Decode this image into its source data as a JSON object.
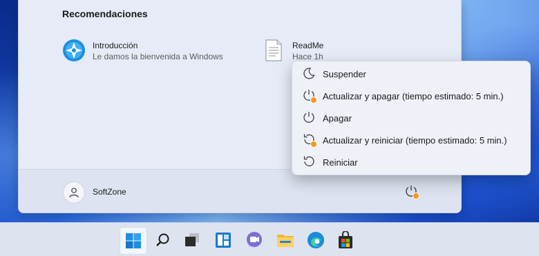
{
  "start_menu": {
    "recommended_title": "Recomendaciones",
    "recommended": [
      {
        "title": "Introducción",
        "subtitle": "Le damos la bienvenida a Windows",
        "icon": "get-started-icon"
      },
      {
        "title": "ReadMe",
        "subtitle": "Hace 1h",
        "icon": "document-icon"
      }
    ],
    "user": {
      "name": "SoftZone",
      "icon": "user-icon"
    },
    "power_icon": "power-update-icon"
  },
  "power_menu": {
    "items": [
      {
        "label": "Suspender",
        "icon": "moon-icon"
      },
      {
        "label": "Actualizar y apagar (tiempo estimado: 5 min.)",
        "icon": "power-update-icon"
      },
      {
        "label": "Apagar",
        "icon": "power-icon"
      },
      {
        "label": "Actualizar y reiniciar (tiempo estimado: 5 min.)",
        "icon": "restart-update-icon"
      },
      {
        "label": "Reiniciar",
        "icon": "restart-icon"
      }
    ]
  },
  "taskbar": {
    "icons": [
      "windows-start-icon",
      "search-icon",
      "task-view-icon",
      "widgets-icon",
      "teams-chat-icon",
      "file-explorer-icon",
      "edge-icon",
      "store-icon"
    ]
  },
  "colors": {
    "accent": "#0067c0",
    "update_badge": "#f7981d",
    "menu_bg": "#e6ebf7"
  }
}
